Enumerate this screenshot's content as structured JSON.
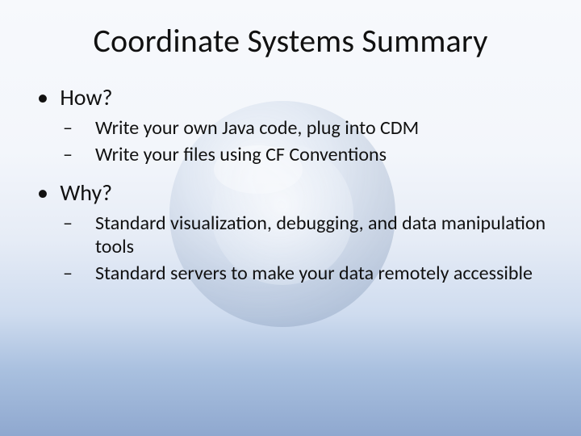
{
  "title": "Coordinate Systems Summary",
  "bullets": [
    {
      "label": "How?",
      "sub": [
        "Write your own Java code, plug into CDM",
        "Write your files using CF Conventions"
      ]
    },
    {
      "label": "Why?",
      "sub": [
        "Standard visualization, debugging, and data manipulation tools",
        "Standard servers to make your data remotely accessible"
      ]
    }
  ]
}
